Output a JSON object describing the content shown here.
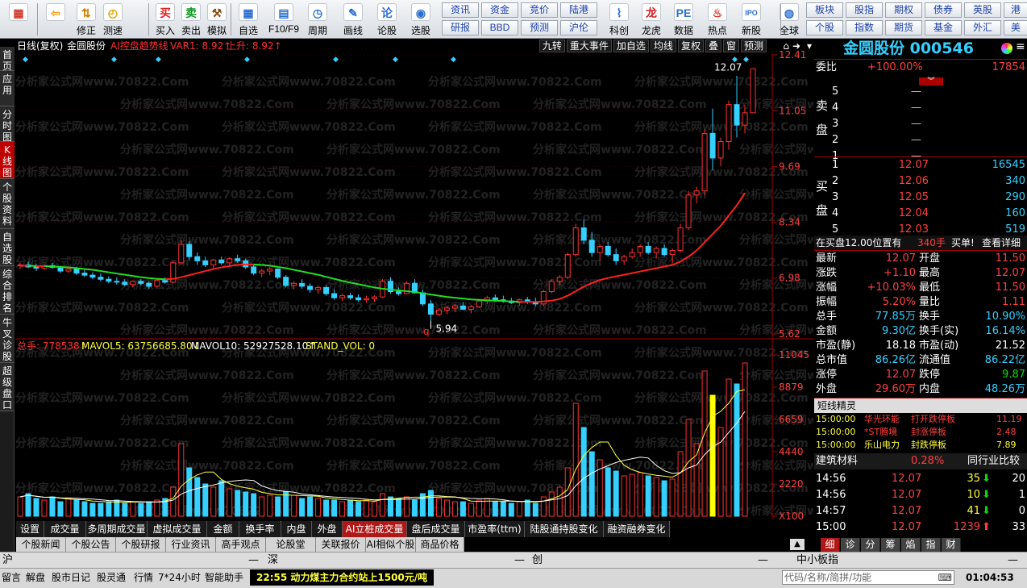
{
  "toolbar": {
    "buttons": [
      {
        "label": "",
        "icon": "app-grid-icon",
        "color": "#d13b2a",
        "glyph": "▦"
      },
      {
        "label": "",
        "icon": "back-arrow-icon",
        "color": "#f0a020",
        "glyph": "⇦"
      },
      {
        "label": "修正",
        "icon": "up-down-arrows-icon",
        "color": "#d08000",
        "glyph": "⇅"
      },
      {
        "label": "测速",
        "icon": "clock-icon",
        "color": "#e0a000",
        "glyph": "◴"
      },
      {
        "label": "买入",
        "icon": "buy-icon",
        "color": "#e02020",
        "glyph": "买"
      },
      {
        "label": "卖出",
        "icon": "sell-icon",
        "color": "#0a9a20",
        "glyph": "卖"
      },
      {
        "label": "模拟",
        "icon": "hammer-icon",
        "color": "#8a4a10",
        "glyph": "⚒"
      },
      {
        "label": "自选",
        "icon": "grid-icon",
        "color": "#2a6fd0",
        "glyph": "▦"
      },
      {
        "label": "F10/F9",
        "icon": "f10-icon",
        "color": "#2a6fd0",
        "glyph": "▤"
      },
      {
        "label": "周期",
        "icon": "cycle-icon",
        "color": "#2a6fd0",
        "glyph": "◷"
      },
      {
        "label": "画线",
        "icon": "pen-icon",
        "color": "#2a6fd0",
        "glyph": "✎"
      },
      {
        "label": "论股",
        "icon": "discuss-icon",
        "color": "#2a6fd0",
        "glyph": "论"
      },
      {
        "label": "选股",
        "icon": "stock-picker-icon",
        "color": "#2a6fd0",
        "glyph": "◉"
      },
      {
        "label": "科创",
        "icon": "sci-tech-icon",
        "color": "#2a6fd0",
        "glyph": "⌇"
      },
      {
        "label": "龙虎",
        "icon": "dragon-icon",
        "color": "#d02020",
        "glyph": "龙"
      },
      {
        "label": "数据",
        "icon": "pe-data-icon",
        "color": "#2a6fd0",
        "glyph": "PE"
      },
      {
        "label": "热点",
        "icon": "hot-icon",
        "color": "#e03020",
        "glyph": "♨"
      },
      {
        "label": "新股",
        "icon": "new-stock-icon",
        "color": "#2a6fd0",
        "glyph": "IPO"
      },
      {
        "label": "全球",
        "icon": "globe-icon",
        "color": "#2a6fd0",
        "glyph": "◍"
      }
    ],
    "grid": [
      [
        "资讯",
        "资金",
        "竞价",
        "陆港"
      ],
      [
        "研报",
        "BBD",
        "预测",
        "沪伦"
      ]
    ],
    "grid2": [
      [
        "板块",
        "股指",
        "期权",
        "债券",
        "英股",
        "港"
      ],
      [
        "个股",
        "指数",
        "期货",
        "基金",
        "外汇",
        "美"
      ]
    ]
  },
  "sidebar": [
    "首页",
    "应用",
    "分时图",
    "K线图",
    "个股资料",
    "自选股",
    "综合排名",
    "牛叉诊股",
    "超级盘口"
  ],
  "chart": {
    "header": {
      "period": "日线(复权)",
      "name": "金圆股份",
      "indicator": "AI控盘趋势线",
      "var1": "VAR1: 8.92↑",
      "rise": "上升: 8.92↑"
    },
    "right_tools": [
      "九转",
      "重大事件",
      "加自选",
      "均线",
      "复权",
      "叠",
      "窗",
      "预测"
    ],
    "price_ticks": [
      "12.41",
      "11.05",
      "9.69",
      "8.34",
      "6.98",
      "5.62"
    ],
    "high_label": "12.07",
    "low_label": "5.94",
    "vol_header": {
      "total": "总手: 778538↑",
      "mav5": "MAVOL5: 63756685.80↓",
      "mav10": "MAVOL10: 52927528.10↑",
      "stand": "STAND_VOL: 0"
    },
    "vol_ticks": [
      "11045",
      "8879",
      "6659",
      "4440",
      "2220",
      "X100"
    ],
    "watermark": "分析家公式网www.70822.Com"
  },
  "chart_data": {
    "type": "candlestick",
    "ylim": [
      5.62,
      12.41
    ],
    "candles": [
      [
        7.28,
        7.35,
        7.2,
        7.3
      ],
      [
        7.3,
        7.38,
        7.22,
        7.25
      ],
      [
        7.25,
        7.32,
        7.15,
        7.22
      ],
      [
        7.22,
        7.3,
        7.18,
        7.28
      ],
      [
        7.28,
        7.35,
        7.2,
        7.24
      ],
      [
        7.24,
        7.28,
        7.1,
        7.15
      ],
      [
        7.15,
        7.25,
        7.1,
        7.2
      ],
      [
        7.2,
        7.26,
        7.05,
        7.1
      ],
      [
        7.1,
        7.18,
        7.0,
        7.05
      ],
      [
        7.05,
        7.12,
        6.95,
        7.0
      ],
      [
        7.0,
        7.1,
        6.9,
        6.95
      ],
      [
        6.95,
        7.02,
        6.85,
        6.9
      ],
      [
        6.9,
        7.0,
        6.82,
        6.88
      ],
      [
        6.88,
        6.95,
        6.78,
        6.82
      ],
      [
        6.82,
        6.92,
        6.75,
        6.9
      ],
      [
        6.9,
        6.95,
        6.8,
        6.85
      ],
      [
        6.85,
        6.9,
        6.72,
        6.78
      ],
      [
        6.78,
        6.95,
        6.75,
        6.92
      ],
      [
        6.92,
        7.0,
        6.85,
        6.88
      ],
      [
        6.88,
        7.4,
        6.85,
        7.35
      ],
      [
        7.35,
        7.9,
        7.3,
        7.8
      ],
      [
        7.8,
        7.88,
        7.4,
        7.5
      ],
      [
        7.5,
        7.6,
        7.3,
        7.4
      ],
      [
        7.4,
        7.5,
        7.25,
        7.3
      ],
      [
        7.3,
        7.45,
        7.2,
        7.42
      ],
      [
        7.42,
        7.5,
        7.3,
        7.35
      ],
      [
        7.35,
        7.48,
        7.28,
        7.45
      ],
      [
        7.45,
        7.55,
        7.35,
        7.4
      ],
      [
        7.4,
        7.45,
        7.2,
        7.25
      ],
      [
        7.25,
        7.3,
        7.05,
        7.1
      ],
      [
        7.1,
        7.2,
        7.0,
        7.15
      ],
      [
        7.15,
        7.25,
        7.05,
        7.2
      ],
      [
        7.2,
        7.22,
        6.95,
        7.0
      ],
      [
        7.0,
        7.05,
        6.75,
        6.8
      ],
      [
        6.8,
        6.9,
        6.7,
        6.85
      ],
      [
        6.85,
        6.95,
        6.72,
        6.78
      ],
      [
        6.78,
        6.85,
        6.62,
        6.7
      ],
      [
        6.7,
        6.8,
        6.6,
        6.75
      ],
      [
        6.75,
        6.82,
        6.55,
        6.6
      ],
      [
        6.6,
        6.7,
        6.45,
        6.5
      ],
      [
        6.5,
        6.6,
        6.42,
        6.55
      ],
      [
        6.55,
        6.62,
        6.45,
        6.5
      ],
      [
        6.5,
        6.58,
        6.4,
        6.45
      ],
      [
        6.45,
        6.55,
        6.38,
        6.48
      ],
      [
        6.48,
        6.56,
        6.4,
        6.52
      ],
      [
        6.52,
        6.95,
        6.5,
        6.9
      ],
      [
        6.9,
        7.0,
        6.6,
        6.65
      ],
      [
        6.65,
        6.75,
        6.55,
        6.6
      ],
      [
        6.6,
        6.9,
        6.58,
        6.85
      ],
      [
        6.85,
        6.95,
        6.6,
        6.62
      ],
      [
        6.62,
        6.7,
        6.3,
        6.35
      ],
      [
        6.35,
        6.45,
        5.94,
        6.1
      ],
      [
        6.1,
        6.25,
        6.05,
        6.2
      ],
      [
        6.2,
        6.3,
        6.1,
        6.25
      ],
      [
        6.25,
        6.35,
        6.15,
        6.3
      ],
      [
        6.3,
        6.4,
        6.2,
        6.22
      ],
      [
        6.22,
        6.32,
        6.12,
        6.28
      ],
      [
        6.28,
        6.45,
        6.25,
        6.42
      ],
      [
        6.42,
        6.55,
        6.35,
        6.5
      ],
      [
        6.5,
        6.58,
        6.4,
        6.45
      ],
      [
        6.45,
        6.55,
        6.38,
        6.42
      ],
      [
        6.42,
        6.5,
        6.35,
        6.38
      ],
      [
        6.38,
        6.48,
        6.3,
        6.45
      ],
      [
        6.45,
        6.52,
        6.35,
        6.4
      ],
      [
        6.4,
        6.5,
        6.3,
        6.35
      ],
      [
        6.35,
        6.7,
        6.3,
        6.65
      ],
      [
        6.65,
        6.95,
        6.6,
        6.9
      ],
      [
        6.9,
        7.05,
        6.8,
        7.0
      ],
      [
        7.0,
        7.6,
        6.95,
        7.55
      ],
      [
        7.55,
        8.3,
        7.5,
        8.2
      ],
      [
        8.2,
        8.4,
        7.8,
        7.9
      ],
      [
        7.9,
        8.1,
        7.5,
        7.6
      ],
      [
        7.6,
        7.8,
        7.4,
        7.75
      ],
      [
        7.75,
        7.85,
        7.5,
        7.55
      ],
      [
        7.55,
        7.7,
        7.3,
        7.4
      ],
      [
        7.4,
        7.55,
        7.3,
        7.5
      ],
      [
        7.5,
        7.7,
        7.45,
        7.6
      ],
      [
        7.6,
        7.8,
        7.5,
        7.75
      ],
      [
        7.75,
        7.85,
        7.55,
        7.6
      ],
      [
        7.6,
        7.75,
        7.45,
        7.7
      ],
      [
        7.7,
        7.8,
        7.5,
        7.55
      ],
      [
        7.55,
        7.7,
        7.35,
        7.65
      ],
      [
        7.65,
        8.3,
        7.6,
        8.2
      ],
      [
        8.2,
        9.1,
        8.15,
        9.0
      ],
      [
        9.0,
        9.2,
        8.8,
        9.1
      ],
      [
        9.1,
        10.6,
        9.0,
        10.5
      ],
      [
        10.5,
        11.1,
        9.6,
        9.9
      ],
      [
        9.9,
        10.4,
        9.7,
        10.3
      ],
      [
        10.3,
        11.3,
        10.1,
        11.2
      ],
      [
        11.2,
        11.9,
        10.4,
        10.7
      ],
      [
        10.7,
        11.2,
        10.5,
        11.0
      ],
      [
        11.0,
        12.07,
        11.0,
        12.07
      ]
    ],
    "volume": [
      12,
      14,
      11,
      10,
      12,
      9,
      11,
      10,
      9,
      8,
      8,
      9,
      10,
      8,
      9,
      8,
      9,
      10,
      11,
      18,
      45,
      30,
      24,
      20,
      18,
      22,
      17,
      16,
      15,
      14,
      12,
      13,
      12,
      15,
      13,
      11,
      12,
      11,
      10,
      10,
      9,
      10,
      9,
      10,
      9,
      14,
      12,
      11,
      12,
      10,
      14,
      16,
      11,
      10,
      9,
      9,
      8,
      10,
      11,
      9,
      9,
      8,
      9,
      10,
      8,
      12,
      15,
      18,
      30,
      70,
      55,
      40,
      35,
      30,
      28,
      25,
      26,
      27,
      25,
      24,
      22,
      23,
      40,
      60,
      45,
      90,
      75,
      55,
      85,
      82,
      95
    ],
    "ma": [
      7.28,
      7.28,
      7.27,
      7.27,
      7.26,
      7.25,
      7.24,
      7.22,
      7.2,
      7.18,
      7.15,
      7.12,
      7.09,
      7.06,
      7.03,
      7.0,
      6.98,
      6.96,
      6.95,
      6.96,
      7.0,
      7.05,
      7.1,
      7.15,
      7.2,
      7.24,
      7.27,
      7.3,
      7.31,
      7.31,
      7.3,
      7.28,
      7.25,
      7.22,
      7.18,
      7.14,
      7.1,
      7.06,
      7.01,
      6.96,
      6.91,
      6.87,
      6.83,
      6.79,
      6.75,
      6.72,
      6.7,
      6.68,
      6.66,
      6.64,
      6.61,
      6.58,
      6.55,
      6.52,
      6.5,
      6.48,
      6.46,
      6.45,
      6.44,
      6.43,
      6.42,
      6.41,
      6.4,
      6.4,
      6.4,
      6.41,
      6.43,
      6.47,
      6.55,
      6.66,
      6.77,
      6.86,
      6.93,
      6.98,
      7.02,
      7.06,
      7.1,
      7.14,
      7.18,
      7.22,
      7.26,
      7.3,
      7.38,
      7.5,
      7.65,
      7.85,
      8.05,
      8.25,
      8.5,
      8.75,
      9.05
    ]
  },
  "right_panel": {
    "title": "金圆股份 000546",
    "weibi": {
      "label": "委比",
      "pct": "+100.00%",
      "num": "17854"
    },
    "sell_label": "卖盘",
    "buy_label": "买盘",
    "asks": [
      {
        "n": "5",
        "p": "—",
        "v": ""
      },
      {
        "n": "4",
        "p": "—",
        "v": ""
      },
      {
        "n": "3",
        "p": "—",
        "v": ""
      },
      {
        "n": "2",
        "p": "—",
        "v": ""
      },
      {
        "n": "1",
        "p": "—",
        "v": ""
      }
    ],
    "bids": [
      {
        "n": "1",
        "p": "12.07",
        "v": "16545"
      },
      {
        "n": "2",
        "p": "12.06",
        "v": "340"
      },
      {
        "n": "3",
        "p": "12.05",
        "v": "290"
      },
      {
        "n": "4",
        "p": "12.04",
        "v": "160"
      },
      {
        "n": "5",
        "p": "12.03",
        "v": "519"
      }
    ],
    "note": {
      "a": "在买盘12.00位置有",
      "b": "340手",
      "c": "买单!",
      "d": "查看详细"
    },
    "stats": [
      [
        "最新",
        "12.07",
        "开盘",
        "11.50"
      ],
      [
        "涨跌",
        "+1.10",
        "最高",
        "12.07"
      ],
      [
        "涨幅",
        "+10.03%",
        "最低",
        "11.50"
      ],
      [
        "振幅",
        "5.20%",
        "量比",
        "1.11"
      ],
      [
        "总手",
        "77.85万",
        "换手",
        "10.90%"
      ],
      [
        "金额",
        "9.30亿",
        "换手(实)",
        "16.14%"
      ],
      [
        "市盈(静)",
        "18.18",
        "市盈(动)",
        "21.52"
      ],
      [
        "总市值",
        "86.26亿",
        "流通值",
        "86.22亿"
      ],
      [
        "涨停",
        "12.07",
        "跌停",
        "9.87"
      ],
      [
        "外盘",
        "29.60万",
        "内盘",
        "48.26万"
      ]
    ],
    "spirit_title": "短线精灵",
    "spirit": [
      [
        "15:00:00",
        "华光环能",
        "打开跌停板",
        "11.19"
      ],
      [
        "15:00:00",
        "*ST腾境",
        "封涨停板",
        "2.48"
      ],
      [
        "15:00:00",
        "乐山电力",
        "封跌停板",
        "7.89"
      ]
    ],
    "sector": {
      "name": "建筑材料",
      "pct": "0.28%",
      "cmp": "同行业比较"
    },
    "ticks": [
      [
        "14:56",
        "12.07",
        "35",
        "20"
      ],
      [
        "14:56",
        "12.07",
        "10",
        "1"
      ],
      [
        "14:57",
        "12.07",
        "41",
        "0"
      ],
      [
        "15:00",
        "12.07",
        "1239",
        "33"
      ]
    ],
    "tabs": [
      "细",
      "诊",
      "分",
      "筹",
      "焰",
      "指",
      "财"
    ]
  },
  "bottom_tabs": [
    "设置",
    "成交量",
    "多周期成交量",
    "虚拟成交量",
    "金额",
    "换手率",
    "内盘",
    "外盘",
    "AI立桩成交量",
    "盘后成交量",
    "市盈率(ttm)",
    "陆股通持股变化",
    "融资融券变化"
  ],
  "news_tabs": [
    "个股新闻",
    "个股公告",
    "个股研报",
    "行业资讯",
    "高手观点",
    "论股堂",
    "关联报价",
    "AI相似个股",
    "商品价格"
  ],
  "index_bar": {
    "sh": "沪",
    "sz": "深",
    "cy": "创",
    "zxb": "中小板指",
    "dash": "—"
  },
  "status": {
    "items": [
      "留言",
      "解盘",
      "股市日记",
      "股灵通",
      "行情",
      "7*24小时",
      "智能助手"
    ],
    "ticker": "22:55 动力煤主力合约站上1500元/吨",
    "search": "代码/名称/简拼/功能",
    "time": "01:04:53"
  }
}
